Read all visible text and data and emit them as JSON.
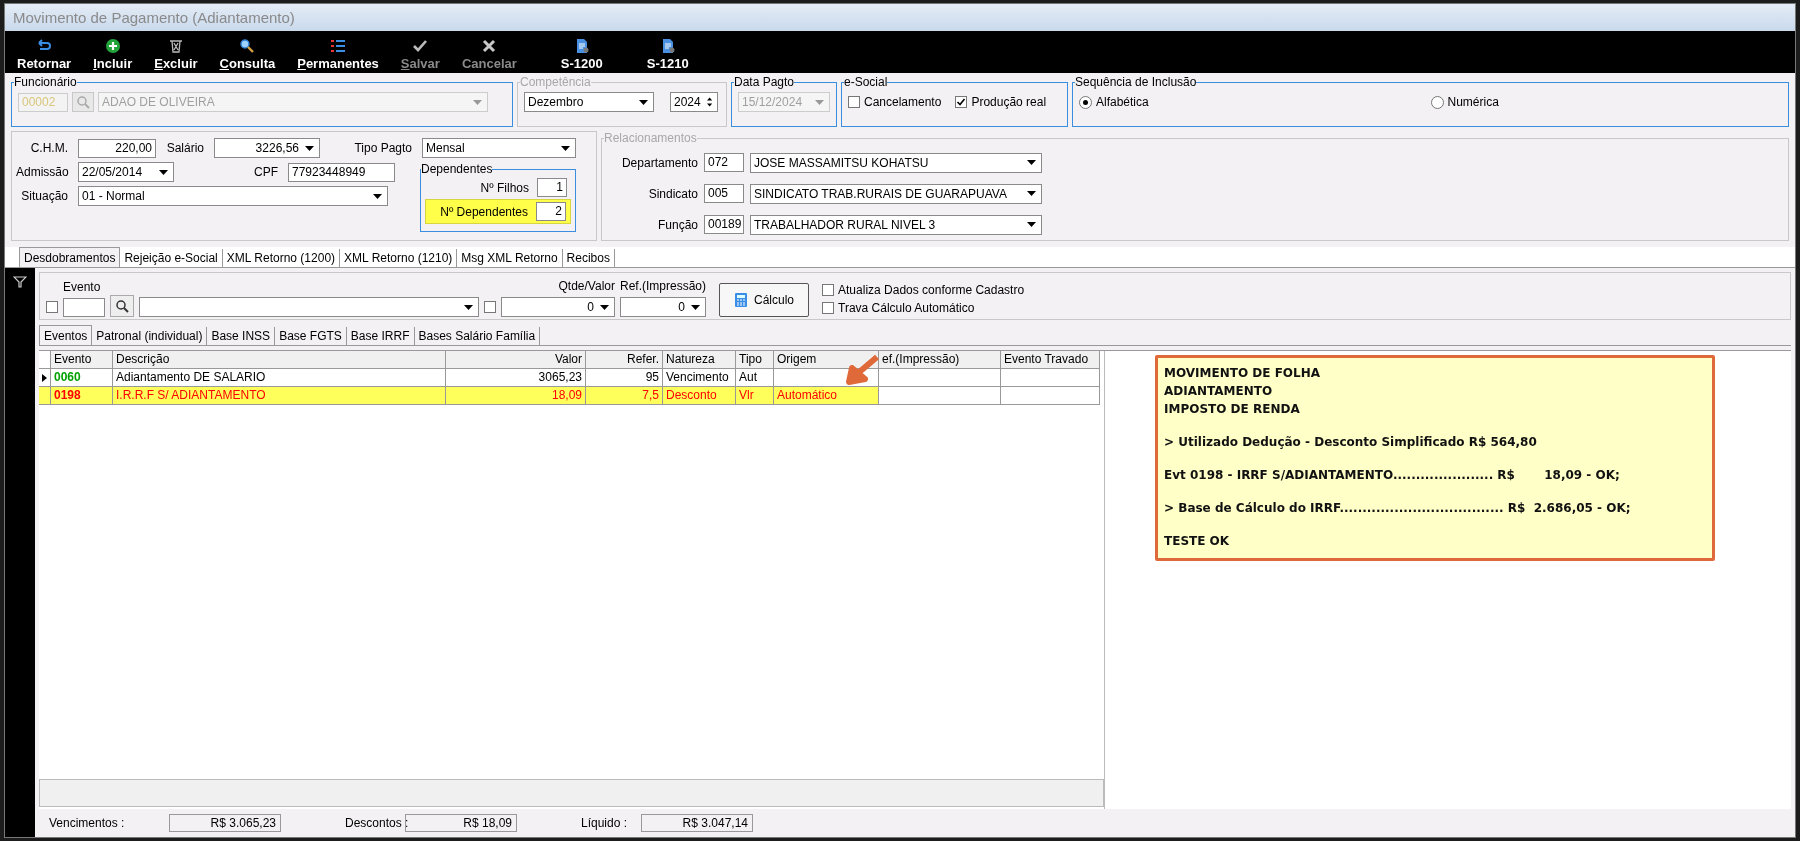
{
  "window": {
    "title": "Movimento de Pagamento (Adiantamento)"
  },
  "toolbar": [
    {
      "label": "Retornar",
      "kind": "undo",
      "mnemonic": false,
      "disabled": false
    },
    {
      "label": "Incluir",
      "kind": "add",
      "mnemonic": true,
      "disabled": false
    },
    {
      "label": "Excluir",
      "kind": "delete",
      "mnemonic": true,
      "disabled": false
    },
    {
      "label": "Consulta",
      "kind": "search",
      "mnemonic": true,
      "disabled": false
    },
    {
      "label": "Permanentes",
      "kind": "list",
      "mnemonic": true,
      "disabled": false
    },
    {
      "label": "Salvar",
      "kind": "save",
      "mnemonic": true,
      "disabled": true
    },
    {
      "label": "Cancelar",
      "kind": "cancel",
      "mnemonic": false,
      "disabled": true
    },
    {
      "label": "S-1200",
      "kind": "document",
      "mnemonic": false,
      "disabled": false
    },
    {
      "label": "S-1210",
      "kind": "document",
      "mnemonic": false,
      "disabled": false
    }
  ],
  "funcionario": {
    "legend": "Funcionário",
    "disabled": false,
    "code": "00002",
    "name": "ADAO DE OLIVEIRA",
    "fields_disabled": true
  },
  "competencia": {
    "legend": "Competência",
    "disabled": true,
    "month": "Dezembro",
    "year": "2024"
  },
  "data_pagto": {
    "legend": "Data Pagto",
    "disabled": false,
    "value": "15/12/2024",
    "field_disabled": true
  },
  "esocial": {
    "legend": "e-Social",
    "disabled": false,
    "options": [
      {
        "label": "Cancelamento",
        "checked": false
      },
      {
        "label": "Produção real",
        "checked": true
      }
    ]
  },
  "sequencia": {
    "legend": "Sequência de Inclusão",
    "disabled": false,
    "options": [
      {
        "label": "Alfabética",
        "selected": true
      },
      {
        "label": "Numérica",
        "selected": false
      }
    ]
  },
  "dados": {
    "chm": {
      "label": "C.H.M.",
      "value": "220,00"
    },
    "salario": {
      "label": "Salário",
      "value": "3226,56"
    },
    "tipo_pagto": {
      "label": "Tipo Pagto",
      "value": "Mensal"
    },
    "admissao": {
      "label": "Admissão",
      "value": "22/05/2014"
    },
    "cpf": {
      "label": "CPF",
      "value": "77923448949"
    },
    "situacao": {
      "label": "Situação",
      "value": "01 - Normal"
    }
  },
  "dependentes": {
    "legend": "Dependentes",
    "disabled": false,
    "fields": [
      {
        "label": "Nº Filhos",
        "value": "1",
        "highlighted": false
      },
      {
        "label": "Nº Dependentes",
        "value": "2",
        "highlighted": true
      }
    ]
  },
  "relacionamentos": {
    "legend": "Relacionamentos",
    "disabled": true,
    "rows": [
      {
        "label": "Departamento",
        "code": "072",
        "name": "JOSE MASSAMITSU KOHATSU"
      },
      {
        "label": "Sindicato",
        "code": "005",
        "name": "SINDICATO TRAB.RURAIS DE GUARAPUAVA"
      },
      {
        "label": "Função",
        "code": "00189",
        "name": "TRABALHADOR RURAL NIVEL 3"
      }
    ]
  },
  "tabs": [
    {
      "label": "Desdobramentos",
      "selected": true
    },
    {
      "label": "Rejeição e-Social",
      "selected": false
    },
    {
      "label": "XML Retorno (1200)",
      "selected": false
    },
    {
      "label": "XML Retorno (1210)",
      "selected": false
    },
    {
      "label": "Msg XML Retorno",
      "selected": false
    },
    {
      "label": "Recibos",
      "selected": false
    }
  ],
  "evento_form": {
    "evento_label": "Evento",
    "evento_checked": false,
    "qtde_checked": false,
    "qtde_label": "Qtde/Valor",
    "qtde_value": "0",
    "ref_label": "Ref.(Impressão)",
    "ref_value": "0",
    "calc_button": "Cálculo",
    "options": [
      {
        "label": "Atualiza Dados conforme Cadastro",
        "checked": false
      },
      {
        "label": "Trava Cálculo Automático",
        "checked": false
      }
    ]
  },
  "subtabs": [
    {
      "label": "Eventos",
      "selected": true
    },
    {
      "label": "Patronal (individual)",
      "selected": false
    },
    {
      "label": "Base INSS",
      "selected": false
    },
    {
      "label": "Base FGTS",
      "selected": false
    },
    {
      "label": "Base IRRF",
      "selected": false
    },
    {
      "label": "Bases Salário Família",
      "selected": false
    }
  ],
  "grid": {
    "columns": [
      "Evento",
      "Descrição",
      "Valor",
      "Refer.",
      "Natureza",
      "Tipo",
      "Origem",
      "ef.(Impressão)",
      "Evento Travado"
    ],
    "rows": [
      {
        "current": true,
        "highlighted": false,
        "kind": "provento",
        "color": "#00a000",
        "evento": "0060",
        "descricao": "Adiantamento DE SALARIO",
        "valor": "3065,23",
        "refer": "95",
        "natureza": "Vencimento",
        "tipo": "Aut"
      },
      {
        "current": false,
        "highlighted": true,
        "kind": "desconto",
        "color": "#ff0000",
        "evento": "0198",
        "descricao": "I.R.R.F S/ ADIANTAMENTO",
        "valor": "18,09",
        "refer": "7,5",
        "natureza": "Desconto",
        "tipo": "Vlr",
        "origem": "Automático"
      }
    ]
  },
  "note": {
    "blocks": [
      [
        "MOVIMENTO DE FOLHA",
        "ADIANTAMENTO",
        "IMPOSTO DE RENDA"
      ],
      [
        "> Utilizado Dedução - Desconto Simplificado R$ 564,80"
      ],
      [
        "Evt 0198 - IRRF S/ADIANTAMENTO...................... R$       18,09 - OK;"
      ],
      [
        "> Base de Cálculo do IRRF.................................... R$  2.686,05 - OK;"
      ],
      [
        "TESTE OK"
      ]
    ]
  },
  "totals": [
    {
      "label": "Vencimentos :",
      "value": "R$ 3.065,23"
    },
    {
      "label": "Descontos  :",
      "value": "R$ 18,09"
    },
    {
      "label": "Líquido :",
      "value": "R$ 3.047,14"
    }
  ]
}
